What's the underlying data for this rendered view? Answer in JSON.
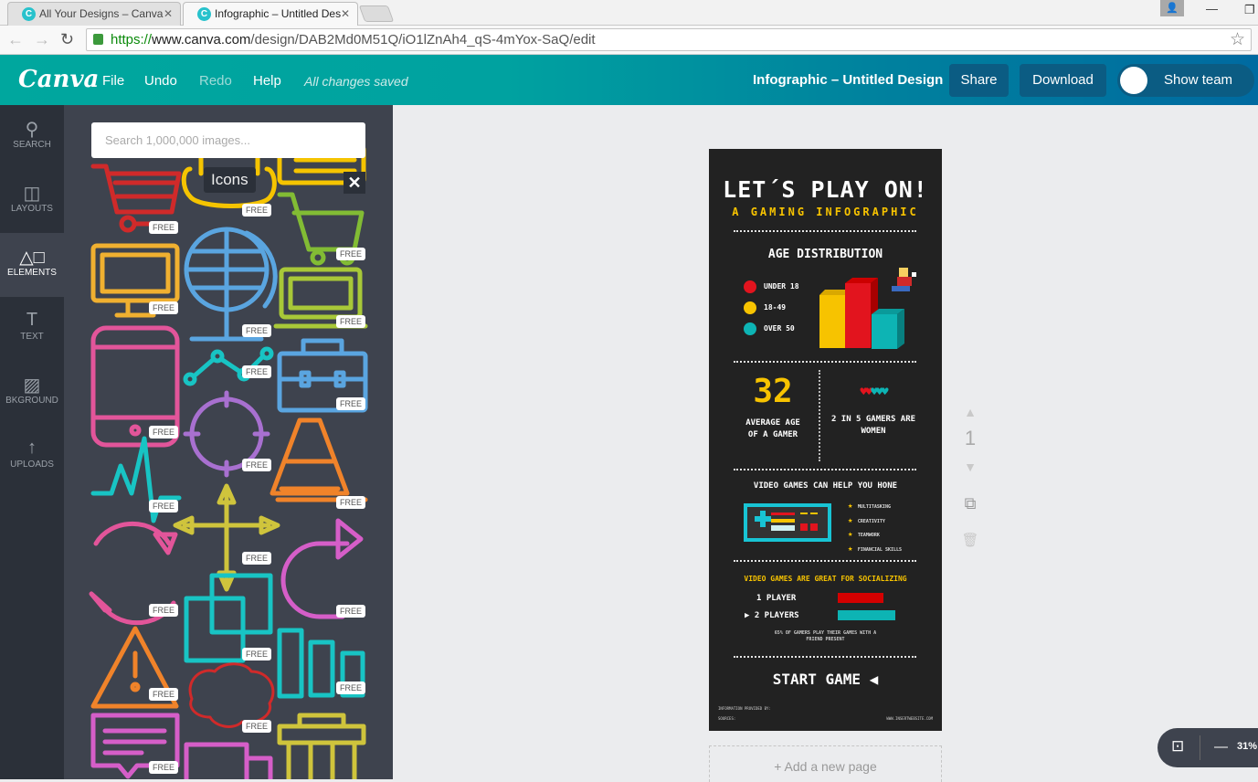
{
  "browser": {
    "tabs": [
      {
        "label": "All Your Designs – Canva",
        "active": false
      },
      {
        "label": "Infographic – Untitled Des",
        "active": true
      }
    ],
    "url_scheme": "https://",
    "url_host": "www.canva.com",
    "url_path": "/design/DAB2Md0M51Q/iO1lZnAh4_qS-4mYox-SaQ/edit"
  },
  "header": {
    "logo": "Canva",
    "menu": [
      "File",
      "Undo",
      "Redo",
      "Help"
    ],
    "status": "All changes saved",
    "design_title": "Infographic – Untitled Design",
    "share": "Share",
    "download": "Download",
    "show_team": "Show team"
  },
  "rail": [
    {
      "label": "SEARCH",
      "icon": "search-icon"
    },
    {
      "label": "LAYOUTS",
      "icon": "layouts-icon"
    },
    {
      "label": "ELEMENTS",
      "icon": "elements-icon",
      "active": true
    },
    {
      "label": "TEXT",
      "icon": "text-icon"
    },
    {
      "label": "BKGROUND",
      "icon": "background-icon"
    },
    {
      "label": "UPLOADS",
      "icon": "upload-icon"
    }
  ],
  "panel": {
    "search_placeholder": "Search 1,000,000 images...",
    "tooltip": "Icons",
    "close": "✕",
    "badge": "FREE"
  },
  "infographic": {
    "title": "LET´S PLAY ON!",
    "subtitle": "A GAMING INFOGRAPHIC",
    "age_heading": "AGE DISTRIBUTION",
    "legend": [
      {
        "label": "UNDER 18",
        "color": "#e2141e"
      },
      {
        "label": "18-49",
        "color": "#f7c300"
      },
      {
        "label": "OVER 50",
        "color": "#0db4b4"
      }
    ],
    "avg_age": "32",
    "avg_label": "AVERAGE AGE OF A GAMER",
    "women_stat": "2 IN 5 GAMERS ARE WOMEN",
    "hone_heading": "VIDEO GAMES CAN HELP YOU HONE",
    "skills": [
      "MULTITASKING",
      "CREATIVITY",
      "TEAMWORK",
      "FINANCIAL SKILLS"
    ],
    "social_heading": "VIDEO GAMES ARE GREAT FOR SOCIALIZING",
    "players": [
      {
        "label": "1 PLAYER",
        "color": "#d40000"
      },
      {
        "label": "▶ 2 PLAYERS",
        "color": "#0db4b4"
      }
    ],
    "social_note": "65% OF GAMERS PLAY THEIR GAMES WITH A FRIEND PRESENT",
    "start": "START GAME ◀",
    "info": "INFORMATION PROVIDED BY:",
    "sources": "SOURCES:",
    "website": "WWW.INSERTWEBSITE.COM"
  },
  "canvas": {
    "page_number": "1",
    "add_page": "+ Add a new page",
    "zoom": "31%"
  }
}
